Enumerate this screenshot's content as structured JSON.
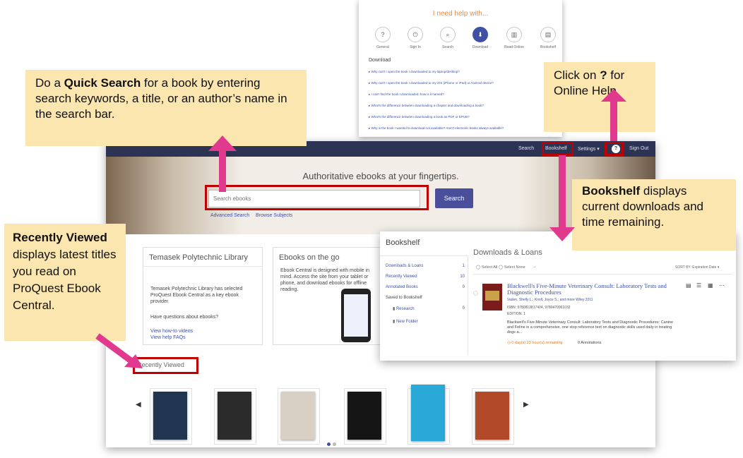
{
  "help_panel": {
    "title": "I need help with...",
    "categories": [
      {
        "label": "General",
        "glyph": "?"
      },
      {
        "label": "Sign In",
        "glyph": "⏻"
      },
      {
        "label": "Search",
        "glyph": "⌕"
      },
      {
        "label": "Download",
        "glyph": "⬇"
      },
      {
        "label": "Read Online",
        "glyph": "▥"
      },
      {
        "label": "Bookshelf",
        "glyph": "▤"
      }
    ],
    "section": "Download",
    "questions": [
      "Why can't I open the book I downloaded to my laptop/desktop?",
      "Why can't I open the book I downloaded to my iOS (iPhone or iPad) or Android device?",
      "I can't find the book I downloaded, how is it named?",
      "What's the difference between downloading a chapter and downloading a book?",
      "What's the difference between downloading a book as PDF or EPUB?",
      "Why is the book I wanted to download not available? Aren't electronic books always available?"
    ]
  },
  "navbar": {
    "search": "Search",
    "bookshelf": "Bookshelf",
    "settings": "Settings ▾",
    "help": "?",
    "signout": "Sign Out"
  },
  "hero": {
    "tagline": "Authoritative ebooks at your fingertips.",
    "search_placeholder": "Search ebooks",
    "search_button": "Search",
    "advanced_search": "Advanced Search",
    "browse_subjects": "Browse Subjects"
  },
  "library_card": {
    "title": "Temasek Polytechnic Library",
    "desc": "Temasek Polytechnic Library has selected ProQuest Ebook Central as a key ebook provider.",
    "question": "Have questions about ebooks?",
    "link1": "View how-to videos",
    "link2": "View help FAQs"
  },
  "mobile_card": {
    "title": "Ebooks on the go",
    "desc": "Ebook Central is designed with mobile in mind. Access the site from your tablet or phone, and download ebooks for offline reading."
  },
  "recent": {
    "label": "Recently Viewed",
    "prev": "◀",
    "next": "▶",
    "cover_colors": [
      "#1f3550",
      "#2b2b2b",
      "#d9d0c4",
      "#151515",
      "#2aa8d8",
      "#b24a2a"
    ]
  },
  "bookshelf": {
    "title": "Bookshelf",
    "sidebar": [
      {
        "label": "Downloads & Loans",
        "count": "1"
      },
      {
        "label": "Recently Viewed",
        "count": "10"
      },
      {
        "label": "Annotated Books",
        "count": "0"
      },
      {
        "label": "Saved to Bookshelf",
        "count": ""
      },
      {
        "label": "Research",
        "count": "0"
      },
      {
        "label": "New Folder",
        "count": ""
      }
    ],
    "heading": "Downloads & Loans",
    "select_all": "Select All",
    "select_none": "Select None",
    "sort": "SORT BY: Expiration Date ▾",
    "book_title": "Blackwell's Five-Minute Veterinary Consult: Laboratory Tests and Diagnostic Procedures",
    "book_authors": "Vaden, Shelly L.; Knoll, Joyce S.; and more  Wiley  2011",
    "isbn": "ISBN: 9780813817404, 9780470961032",
    "edition": "EDITION: 1",
    "summary": "Blackwell's Five-Minute Veterinary Consult: Laboratory Tests and Diagnostic Procedures: Canine and Feline is a comprehensive, one stop reference text on diagnostic skills used daily in treating dogs a...",
    "remaining": "0 day(s) 23 hour(s) remaining",
    "annotations": "0  Annotations"
  },
  "callouts": {
    "quick_search_pre": "Do a ",
    "quick_search_bold": "Quick Search",
    "quick_search_post": " for a book by entering search keywords, a title, or an author’s name in the search bar.",
    "help_pre": "Click on ",
    "help_bold": "?",
    "help_post": " for Online Help",
    "bookshelf_bold": "Bookshelf",
    "bookshelf_post": " displays current downloads and time remaining.",
    "recent_bold": "Recently Viewed",
    "recent_post": " displays latest titles you read on ProQuest Ebook Central."
  },
  "colors": {
    "callout_bg": "#fbe6b0",
    "highlight_red": "#c00000",
    "arrow_pink": "#e0398d",
    "navbar": "#2d3453",
    "accent": "#3f51a5"
  }
}
